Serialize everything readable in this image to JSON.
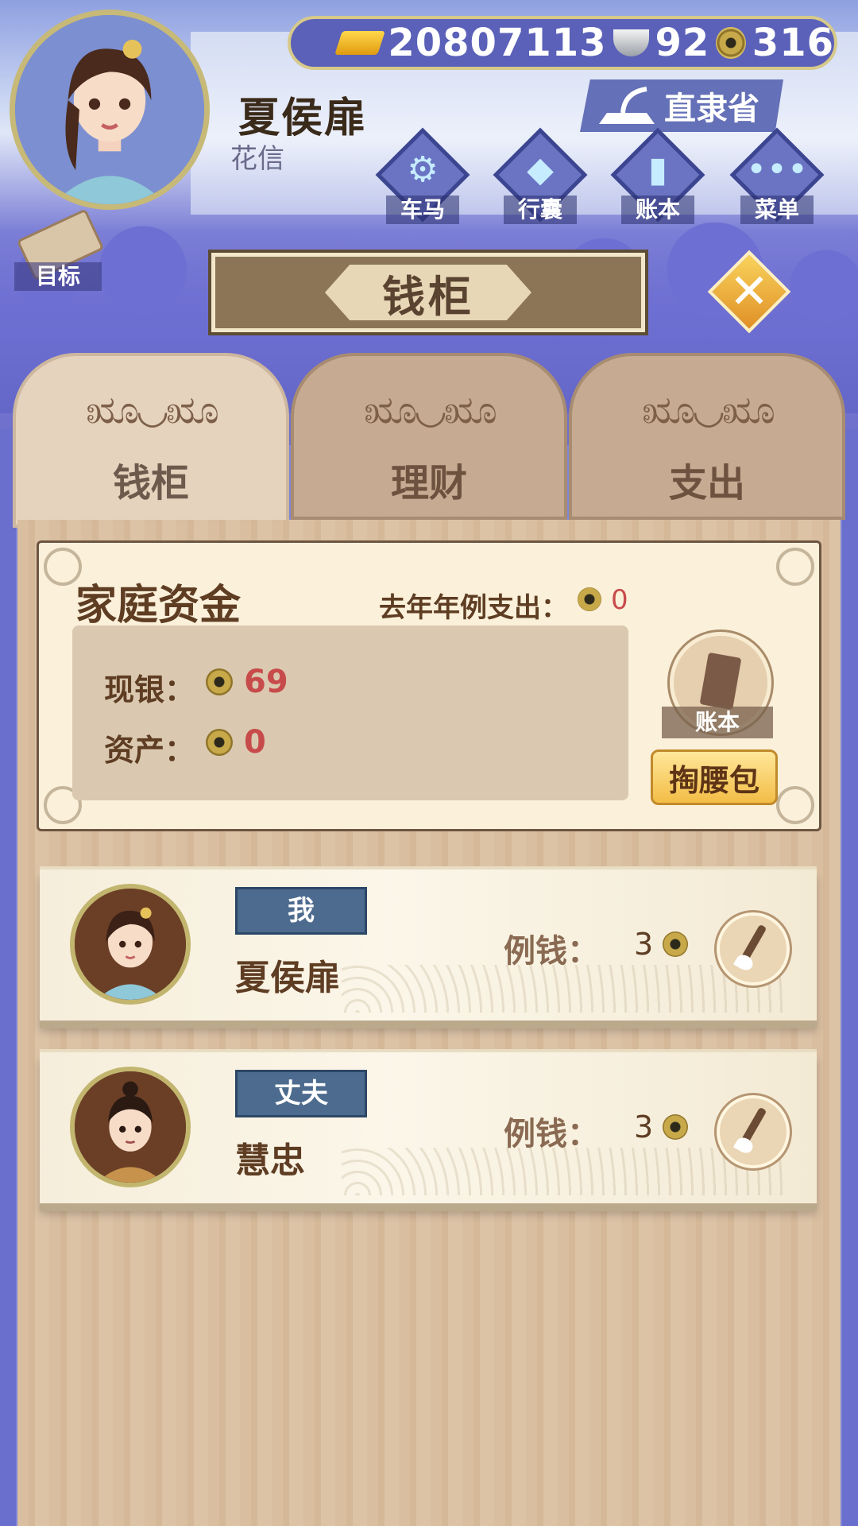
{
  "header": {
    "player_name": "夏侯扉",
    "player_title": "花信",
    "currency": {
      "gold": "20807113",
      "silver": "92",
      "copper": "316"
    },
    "region": "直隶省"
  },
  "nav": [
    {
      "label": "车马",
      "icon": "carriage-icon"
    },
    {
      "label": "行囊",
      "icon": "bag-icon"
    },
    {
      "label": "账本",
      "icon": "ledger-icon"
    },
    {
      "label": "菜单",
      "icon": "menu-icon"
    }
  ],
  "goal_label": "目标",
  "panel_title": "钱柜",
  "tabs": [
    {
      "label": "钱柜",
      "active": true
    },
    {
      "label": "理财",
      "active": false
    },
    {
      "label": "支出",
      "active": false
    }
  ],
  "family": {
    "title": "家庭资金",
    "last_year_label": "去年年例支出：",
    "last_year_value": "0",
    "cash_label": "现银：",
    "cash_value": "69",
    "assets_label": "资产：",
    "assets_value": "0",
    "ledger_label": "账本",
    "purse_label": "掏腰包"
  },
  "members": [
    {
      "role": "我",
      "name": "夏侯扉",
      "allowance_label": "例钱：",
      "allowance_value": "3"
    },
    {
      "role": "丈夫",
      "name": "慧忠",
      "allowance_label": "例钱：",
      "allowance_value": "3"
    }
  ],
  "colors": {
    "accent_red": "#c84b4b",
    "role_badge": "#4c6b8e",
    "coin": "#c8a94a"
  }
}
